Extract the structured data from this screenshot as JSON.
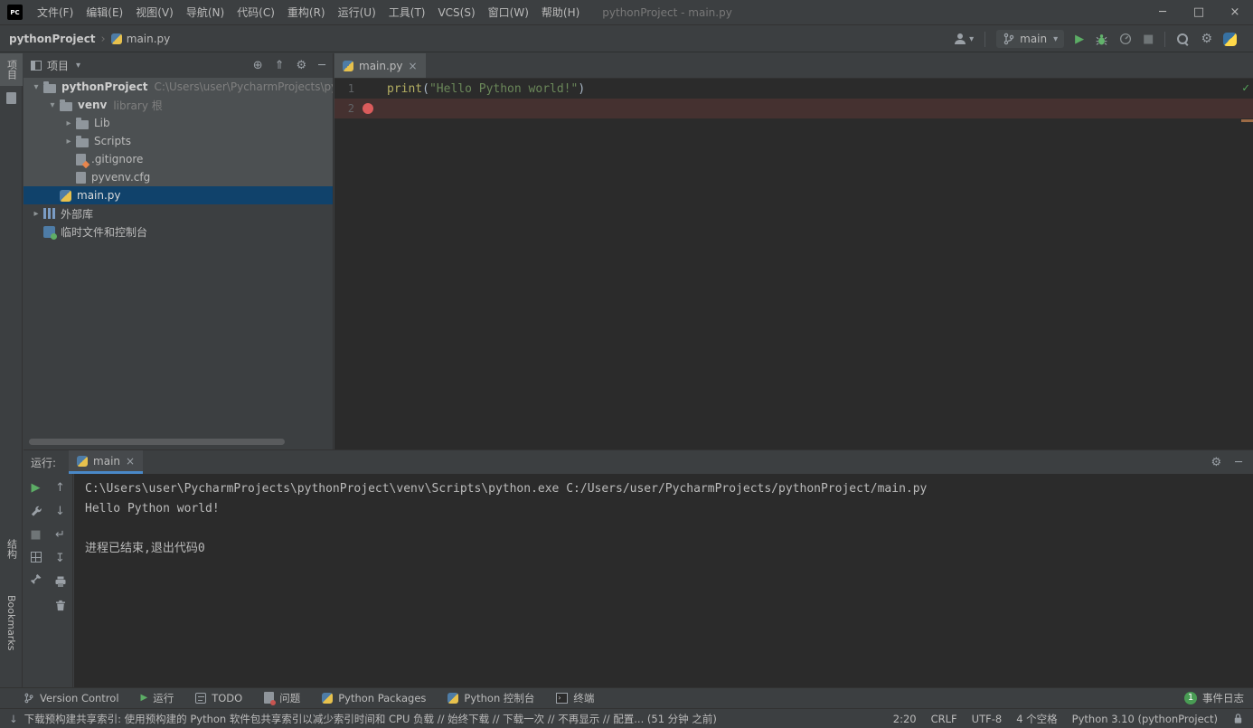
{
  "colors": {
    "panel_bg": "#3c3f41",
    "editor_bg": "#2b2b2b",
    "selection_blue": "#10426b",
    "tree_band_gray": "#4c5052",
    "breakpoint_line": "#453130",
    "breakpoint_red": "#db5c5c",
    "run_green": "#5cad65",
    "tab_underline_blue": "#4a88c7",
    "string_green": "#6a8759"
  },
  "icons": {
    "gear": "⚙",
    "minimize": "─",
    "maximize": "□",
    "close": "×",
    "chev_down": "▾",
    "chev_right": "▸",
    "play": "▶",
    "stop": "■",
    "up": "↑",
    "down": "↓",
    "soft_wrap": "↵",
    "scroll_end": "↧",
    "check": "✓",
    "locate": "⊕",
    "collapse": "⇑",
    "separator": "›"
  },
  "title_bar": {
    "logo": "PC",
    "menus": [
      "文件(F)",
      "编辑(E)",
      "视图(V)",
      "导航(N)",
      "代码(C)",
      "重构(R)",
      "运行(U)",
      "工具(T)",
      "VCS(S)",
      "窗口(W)",
      "帮助(H)"
    ],
    "title": "pythonProject - main.py"
  },
  "nav_bar": {
    "breadcrumb_project": "pythonProject",
    "breadcrumb_file": "main.py",
    "branch_name": "main"
  },
  "tool_stripe": {
    "project": "项目",
    "structure": "结构",
    "bookmarks": "Bookmarks"
  },
  "project": {
    "header": "项目",
    "tree": [
      {
        "label": "pythonProject",
        "meta": "C:\\Users\\user\\PycharmProjects\\pyth"
      },
      {
        "label": "venv",
        "meta": "library 根"
      },
      {
        "label": "Lib"
      },
      {
        "label": "Scripts"
      },
      {
        "label": ".gitignore"
      },
      {
        "label": "pyvenv.cfg"
      },
      {
        "label": "main.py"
      },
      {
        "label": "外部库"
      },
      {
        "label": "临时文件和控制台"
      }
    ]
  },
  "editor": {
    "tab_label": "main.py",
    "line1_number": "1",
    "line2_number": "2",
    "code": {
      "func": "print",
      "open_paren": "(",
      "string_arg": "\"Hello Python world!\"",
      "close_paren": ")"
    }
  },
  "run_panel": {
    "label": "运行:",
    "tab_label": "main",
    "console_lines": [
      "C:\\Users\\user\\PycharmProjects\\pythonProject\\venv\\Scripts\\python.exe C:/Users/user/PycharmProjects/pythonProject/main.py",
      "Hello Python world!",
      "",
      "进程已结束,退出代码0"
    ]
  },
  "bottom_bar": {
    "version_control": "Version Control",
    "run": "运行",
    "todo": "TODO",
    "problems": "问题",
    "packages": "Python Packages",
    "python_console": "Python 控制台",
    "terminal": "终端",
    "event_log": "事件日志",
    "event_count": "1"
  },
  "status_bar": {
    "message": "下载预构建共享索引: 使用预构建的 Python 软件包共享索引以减少索引时间和 CPU 负载 // 始终下载 // 下载一次 // 不再显示 // 配置... (51 分钟 之前)",
    "caret": "2:20",
    "line_sep": "CRLF",
    "encoding": "UTF-8",
    "indent": "4 个空格",
    "interpreter": "Python 3.10 (pythonProject)"
  }
}
